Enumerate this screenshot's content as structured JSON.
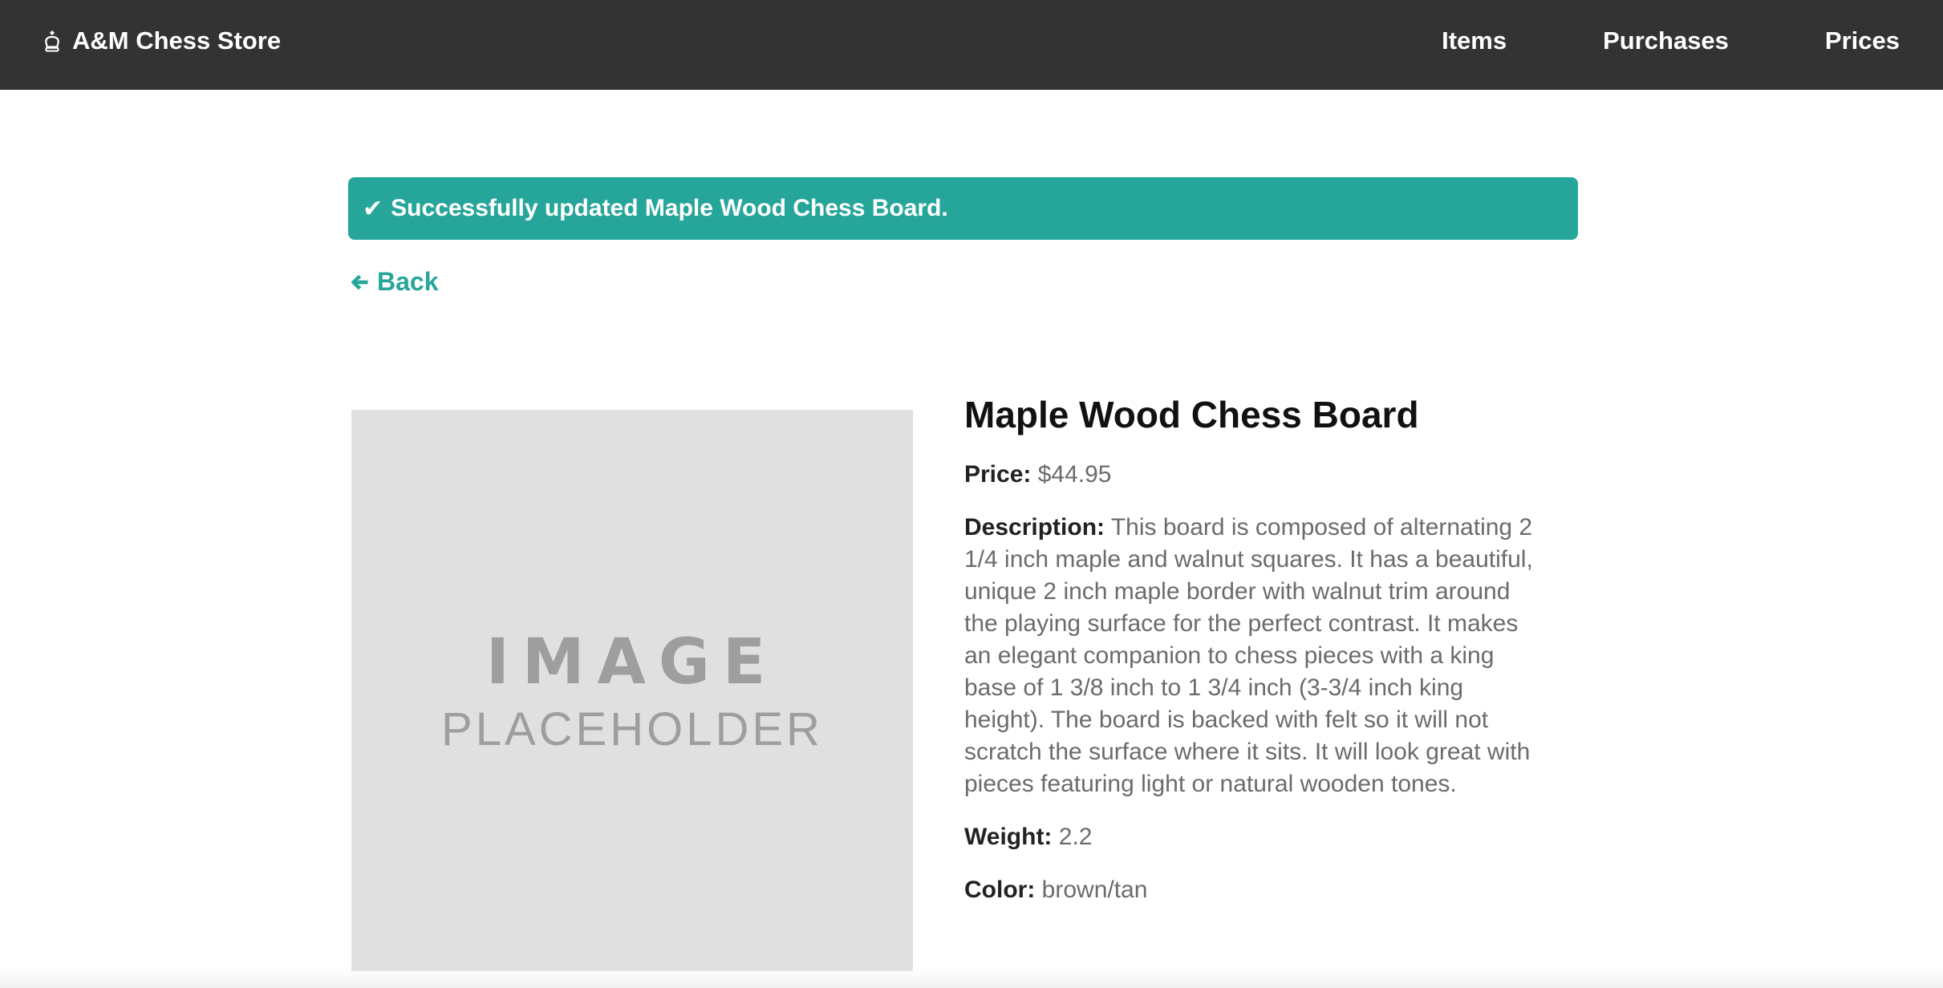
{
  "navbar": {
    "brand": "A&M Chess Store",
    "brand_icon": "chess-king-icon",
    "links": [
      "Items",
      "Purchases",
      "Prices"
    ]
  },
  "flash": {
    "icon": "✔",
    "message": "Successfully updated Maple Wood Chess Board."
  },
  "back": {
    "label": "Back",
    "icon": "arrow-left-icon"
  },
  "image": {
    "line1": "IMAGE",
    "line2": "PLACEHOLDER"
  },
  "item": {
    "name": "Maple Wood Chess Board",
    "price_label": "Price:",
    "price": "$44.95",
    "description_label": "Description:",
    "description": "This board is composed of alternating 2 1/4 inch maple and walnut squares. It has a beautiful, unique 2 inch maple border with walnut trim around the playing surface for the perfect contrast. It makes an elegant companion to chess pieces with a king base of 1 3/8 inch to 1 3/4 inch (3-3/4 inch king height). The board is backed with felt so it will not scratch the surface where it sits. It will look great with pieces featuring light or natural wooden tones.",
    "weight_label": "Weight:",
    "weight": "2.2",
    "color_label": "Color:",
    "color": "brown/tan"
  },
  "colors": {
    "navbar": "#333333",
    "accent": "#26a69a",
    "placeholder_bg": "#e0e0e0"
  }
}
